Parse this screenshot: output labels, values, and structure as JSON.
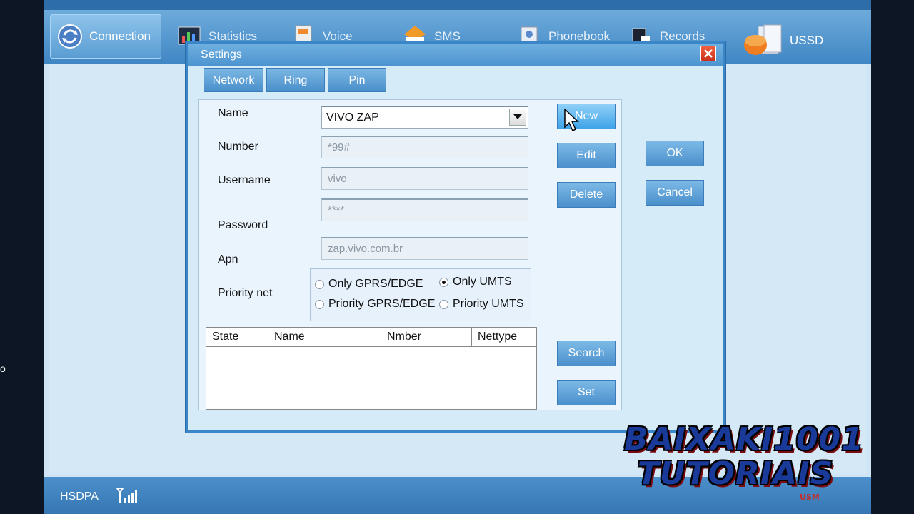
{
  "toolbar": {
    "items": [
      {
        "label": "Connection",
        "icon": "connection-icon"
      },
      {
        "label": "Statistics",
        "icon": "statistics-icon"
      },
      {
        "label": "Voice",
        "icon": "voice-icon"
      },
      {
        "label": "SMS",
        "icon": "sms-icon"
      },
      {
        "label": "Phonebook",
        "icon": "phonebook-icon"
      },
      {
        "label": "Records",
        "icon": "records-icon"
      },
      {
        "label": "USSD",
        "icon": "ussd-icon"
      }
    ]
  },
  "dialog": {
    "title": "Settings",
    "tabs": [
      "Network",
      "Ring",
      "Pin"
    ],
    "fields": {
      "name_label": "Name",
      "name_value": "VIVO ZAP",
      "number_label": "Number",
      "number_value": "*99#",
      "username_label": "Username",
      "username_value": "vivo",
      "password_label": "Password",
      "password_value": "****",
      "apn_label": "Apn",
      "apn_value": "zap.vivo.com.br",
      "priority_label": "Priority net"
    },
    "priority_options": [
      {
        "label": "Only GPRS/EDGE",
        "selected": false
      },
      {
        "label": "Only UMTS",
        "selected": true
      },
      {
        "label": "Priority GPRS/EDGE",
        "selected": false
      },
      {
        "label": "Priority UMTS",
        "selected": false
      }
    ],
    "table": {
      "columns": [
        "State",
        "Name",
        "Nmber",
        "Nettype"
      ],
      "rows": []
    },
    "buttons": {
      "new": "New",
      "edit": "Edit",
      "delete": "Delete",
      "search": "Search",
      "set": "Set",
      "ok": "OK",
      "cancel": "Cancel"
    }
  },
  "status": {
    "network": "HSDPA"
  },
  "watermark": {
    "line1": "BAIXAKI1001",
    "line2": "TUTORIAIS",
    "small": "USM"
  },
  "colors": {
    "accent": "#4a8fcb",
    "close": "#d8402a",
    "background": "#d4e8f6"
  }
}
